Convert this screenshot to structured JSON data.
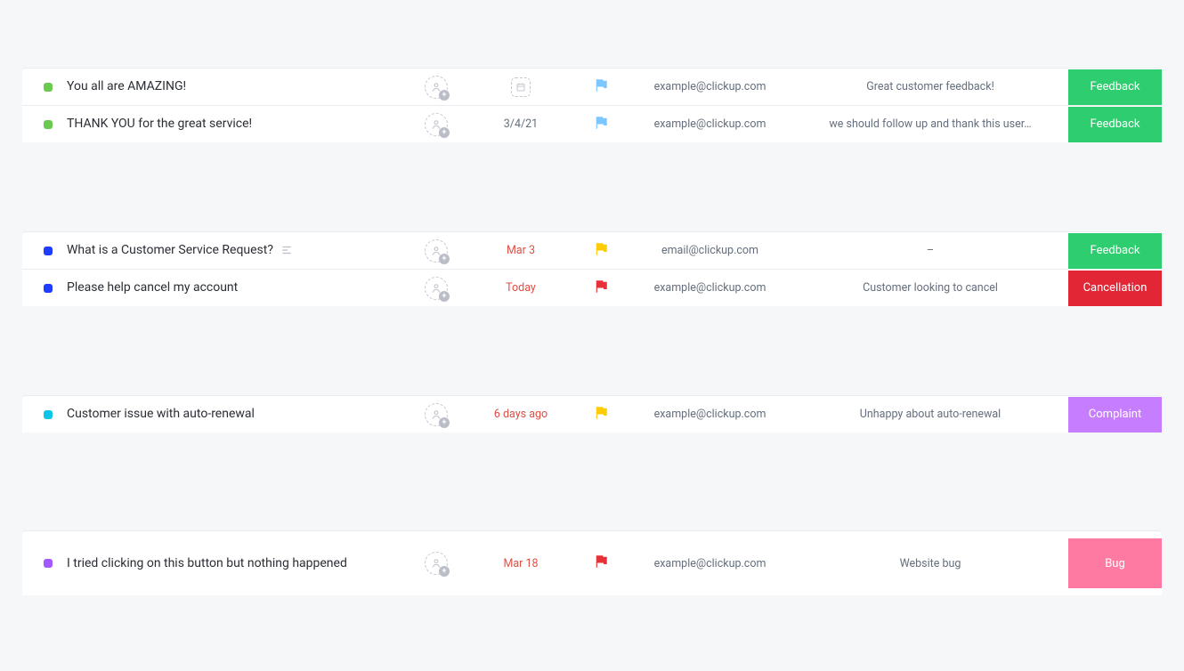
{
  "groups": [
    {
      "rows": [
        {
          "status_color": "lime",
          "title": "You all are AMAZING!",
          "has_description_icon": false,
          "date": "",
          "date_style": "empty",
          "flag_color": "skyblue",
          "email": "example@clickup.com",
          "comment": "Great customer feedback!",
          "tag_label": "Feedback",
          "tag_color": "green",
          "tall": false
        },
        {
          "status_color": "lime",
          "title": "THANK YOU for the great service!",
          "has_description_icon": false,
          "date": "3/4/21",
          "date_style": "normal",
          "flag_color": "skyblue",
          "email": "example@clickup.com",
          "comment": "we should follow up and thank this user…",
          "tag_label": "Feedback",
          "tag_color": "green",
          "tall": false
        }
      ]
    },
    {
      "rows": [
        {
          "status_color": "blue",
          "title": "What is a Customer Service Request?",
          "has_description_icon": true,
          "date": "Mar 3",
          "date_style": "red",
          "flag_color": "yellow",
          "email": "email@clickup.com",
          "comment": "–",
          "tag_label": "Feedback",
          "tag_color": "green",
          "tall": false
        },
        {
          "status_color": "blue",
          "title": "Please help cancel my account",
          "has_description_icon": false,
          "date": "Today",
          "date_style": "red",
          "flag_color": "red",
          "email": "example@clickup.com",
          "comment": "Customer looking to cancel",
          "tag_label": "Cancellation",
          "tag_color": "red",
          "tall": false
        }
      ]
    },
    {
      "rows": [
        {
          "status_color": "cyan",
          "title": "Customer issue with auto-renewal",
          "has_description_icon": false,
          "date": "6 days ago",
          "date_style": "red",
          "flag_color": "yellow",
          "email": "example@clickup.com",
          "comment": "Unhappy about auto-renewal",
          "tag_label": "Complaint",
          "tag_color": "violet",
          "tall": false
        }
      ]
    },
    {
      "rows": [
        {
          "status_color": "purple",
          "title": "I tried clicking on this button but nothing happened",
          "has_description_icon": false,
          "date": "Mar 18",
          "date_style": "red",
          "flag_color": "red",
          "email": "example@clickup.com",
          "comment": "Website bug",
          "tag_label": "Bug",
          "tag_color": "pink",
          "tall": true
        }
      ]
    }
  ]
}
